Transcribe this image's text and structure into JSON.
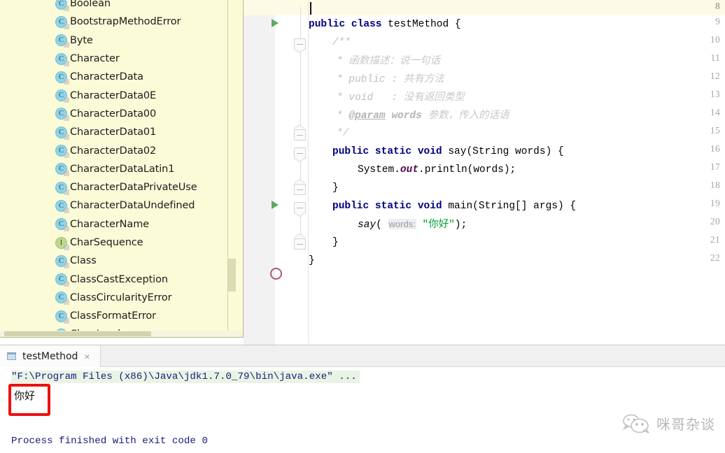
{
  "editor": {
    "lines": [
      {
        "num": "8",
        "marker": "none"
      },
      {
        "num": "9",
        "marker": "run"
      },
      {
        "num": "10",
        "marker": "none"
      },
      {
        "num": "11",
        "marker": "none"
      },
      {
        "num": "12",
        "marker": "none"
      },
      {
        "num": "13",
        "marker": "none"
      },
      {
        "num": "14",
        "marker": "none"
      },
      {
        "num": "15",
        "marker": "none"
      },
      {
        "num": "16",
        "marker": "none"
      },
      {
        "num": "17",
        "marker": "none"
      },
      {
        "num": "18",
        "marker": "none"
      },
      {
        "num": "19",
        "marker": "run"
      },
      {
        "num": "20",
        "marker": "none"
      },
      {
        "num": "21",
        "marker": "none"
      },
      {
        "num": "22",
        "marker": "stop"
      }
    ],
    "code": {
      "l8": "",
      "l9_kw1": "public",
      "l9_kw2": "class",
      "l9_name": "testMethod",
      "l9_brace": "{",
      "l10": "/**",
      "l11_star": "* ",
      "l11_cn": "函数描述：说一句话",
      "l12_star": "* ",
      "l12_code": "public : ",
      "l12_cn": "共有方法",
      "l13_star": "* ",
      "l13_code": "void   : ",
      "l13_cn": "没有返回类型",
      "l14_star": "* ",
      "l14_tag": "@param",
      "l14_param": "words",
      "l14_cn": "参数，传入的话语",
      "l15": "*/",
      "l16_kw": "public static void",
      "l16_sig": "say(String words) {",
      "l17_sys": "System.",
      "l17_out": "out",
      "l17_rest": ".println(words);",
      "l18": "}",
      "l19_kw": "public static void",
      "l19_sig": "main(String[] args) {",
      "l20_call": "say",
      "l20_open": "(",
      "l20_hint": "words:",
      "l20_str": "\"你好\"",
      "l20_close": ");",
      "l21": "}",
      "l22": "}"
    }
  },
  "autocomplete": {
    "items": [
      {
        "label": "Boolean",
        "kind": "C"
      },
      {
        "label": "BootstrapMethodError",
        "kind": "C"
      },
      {
        "label": "Byte",
        "kind": "C"
      },
      {
        "label": "Character",
        "kind": "C"
      },
      {
        "label": "CharacterData",
        "kind": "C"
      },
      {
        "label": "CharacterData0E",
        "kind": "C"
      },
      {
        "label": "CharacterData00",
        "kind": "C"
      },
      {
        "label": "CharacterData01",
        "kind": "C"
      },
      {
        "label": "CharacterData02",
        "kind": "C"
      },
      {
        "label": "CharacterDataLatin1",
        "kind": "C"
      },
      {
        "label": "CharacterDataPrivateUse",
        "kind": "C"
      },
      {
        "label": "CharacterDataUndefined",
        "kind": "C"
      },
      {
        "label": "CharacterName",
        "kind": "C"
      },
      {
        "label": "CharSequence",
        "kind": "I"
      },
      {
        "label": "Class",
        "kind": "C"
      },
      {
        "label": "ClassCastException",
        "kind": "C"
      },
      {
        "label": "ClassCircularityError",
        "kind": "C"
      },
      {
        "label": "ClassFormatError",
        "kind": "C"
      },
      {
        "label": "ClassLoader",
        "kind": "C"
      }
    ]
  },
  "bottom_panel": {
    "tab_label": "testMethod",
    "tab_close": "×",
    "console": {
      "command": "\"F:\\Program Files (x86)\\Java\\jdk1.7.0_79\\bin\\java.exe\" ...",
      "output": "你好",
      "status": "Process finished with exit code 0"
    }
  },
  "watermark": {
    "text": "咪哥杂谈"
  },
  "colors": {
    "keyword": "#000080",
    "string": "#00a033",
    "comment": "#c0c0c0",
    "popup_bg": "#fbfbd8",
    "annotation_red": "#ee1111",
    "run_green": "#5caa5c"
  }
}
